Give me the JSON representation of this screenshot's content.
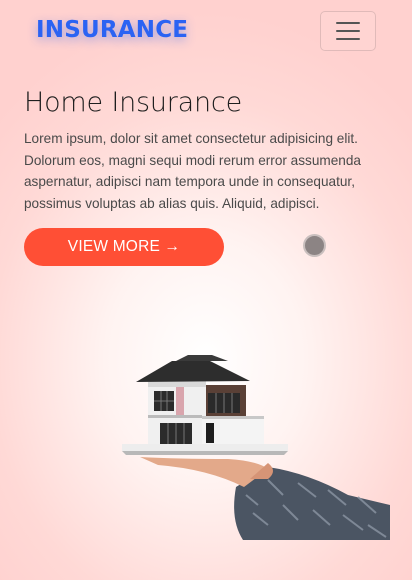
{
  "brand": {
    "name": "INSURANCE",
    "color": "#2b63f3"
  },
  "navbar": {
    "toggle_icon": "hamburger-menu-icon"
  },
  "hero": {
    "title": "Home Insurance",
    "text": "Lorem ipsum, dolor sit amet consectetur adipisicing elit. Dolorum eos, magni sequi modi rerum error assumenda aspernatur, adipisci nam tempora unde in consequatur, possimus voluptas ab alias quis. Aliquid, adipisci.",
    "cta_label": "VIEW MORE →",
    "cta_color": "#ff4f35"
  },
  "image": {
    "subject": "house-model-on-hand"
  }
}
